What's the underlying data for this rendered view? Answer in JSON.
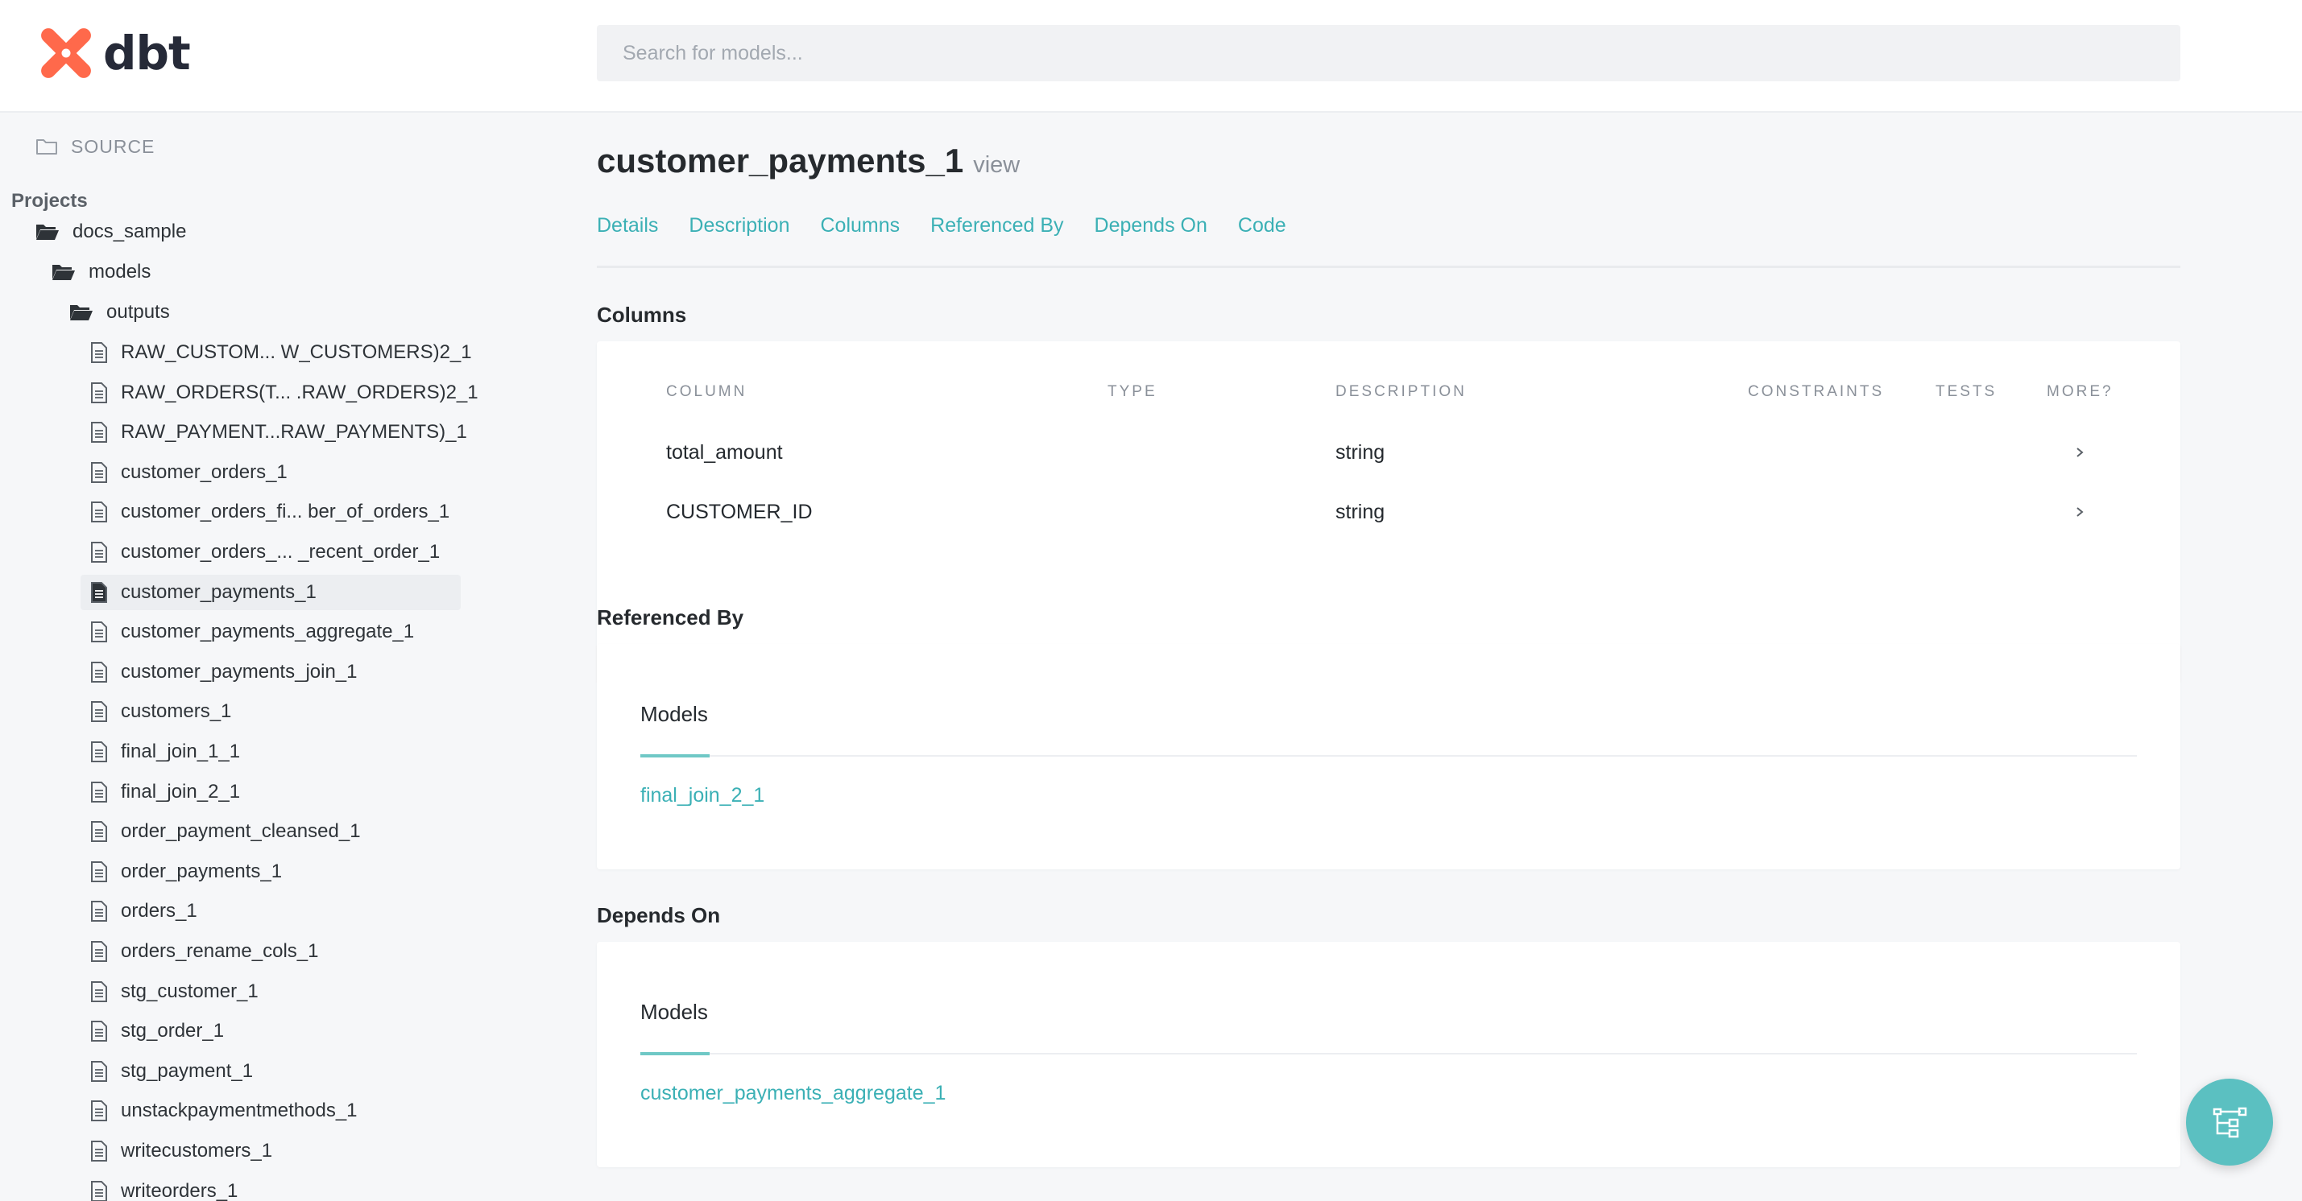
{
  "app": {
    "logo_text": "dbt",
    "brand_color": "#ff694b",
    "accent_color": "#3bb0b5"
  },
  "search": {
    "placeholder": "Search for models..."
  },
  "sidebar": {
    "source_label": "SOURCE",
    "projects_heading": "Projects",
    "project": "docs_sample",
    "folder_models": "models",
    "folder_outputs": "outputs",
    "files": [
      "RAW_CUSTOM... W_CUSTOMERS)2_1",
      "RAW_ORDERS(T... .RAW_ORDERS)2_1",
      "RAW_PAYMENT...RAW_PAYMENTS)_1",
      "customer_orders_1",
      "customer_orders_fi... ber_of_orders_1",
      "customer_orders_...  _recent_order_1",
      "customer_payments_1",
      "customer_payments_aggregate_1",
      "customer_payments_join_1",
      "customers_1",
      "final_join_1_1",
      "final_join_2_1",
      "order_payment_cleansed_1",
      "order_payments_1",
      "orders_1",
      "orders_rename_cols_1",
      "stg_customer_1",
      "stg_order_1",
      "stg_payment_1",
      "unstackpaymentmethods_1",
      "writecustomers_1",
      "writeorders_1"
    ],
    "active_file": "customer_payments_1"
  },
  "model": {
    "name": "customer_payments_1",
    "materialization": "view"
  },
  "tabs": [
    "Details",
    "Description",
    "Columns",
    "Referenced By",
    "Depends On",
    "Code"
  ],
  "columns_section": {
    "heading": "Columns",
    "headers": {
      "column": "COLUMN",
      "type": "TYPE",
      "description": "DESCRIPTION",
      "constraints": "CONSTRAINTS",
      "tests": "TESTS",
      "more": "MORE?"
    },
    "rows": [
      {
        "column": "total_amount",
        "description": "string"
      },
      {
        "column": "CUSTOMER_ID",
        "description": "string"
      }
    ]
  },
  "referenced_by": {
    "heading": "Referenced By",
    "models_label": "Models",
    "models": [
      "final_join_2_1"
    ]
  },
  "depends_on": {
    "heading": "Depends On",
    "models_label": "Models",
    "models": [
      "customer_payments_aggregate_1"
    ]
  }
}
